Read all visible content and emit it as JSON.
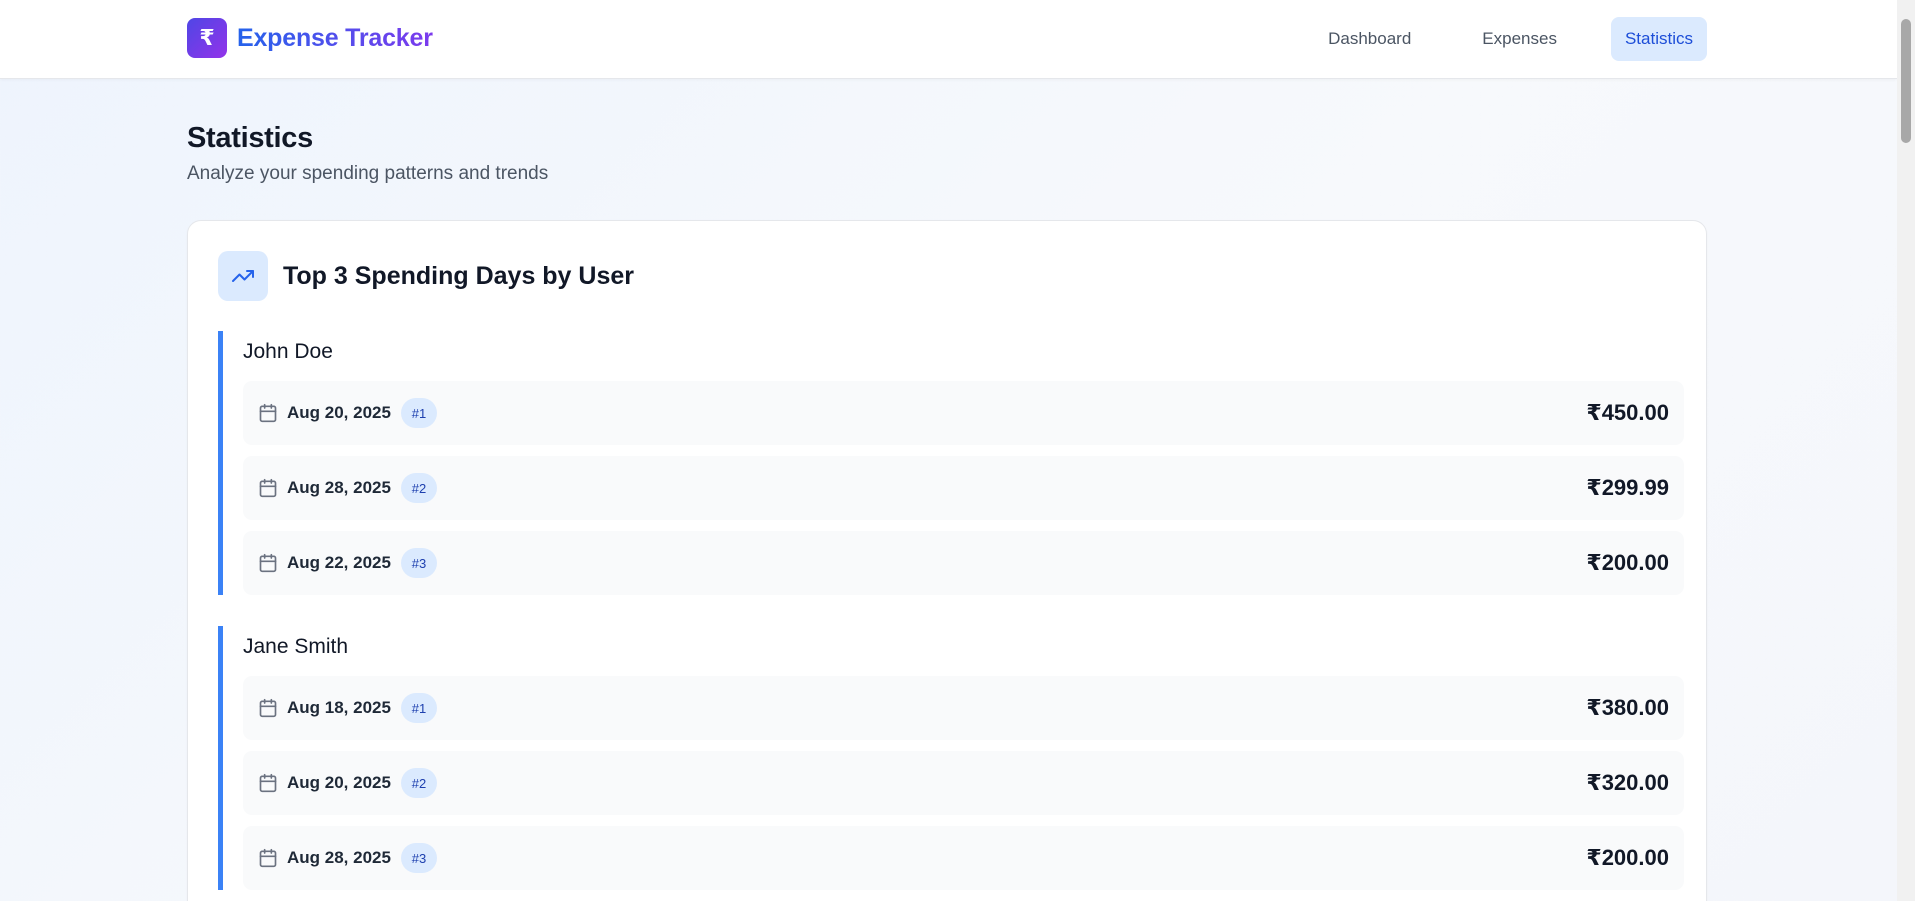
{
  "brand": {
    "logo_symbol": "₹",
    "name": "Expense Tracker"
  },
  "nav": {
    "items": [
      {
        "label": "Dashboard",
        "active": false
      },
      {
        "label": "Expenses",
        "active": false
      },
      {
        "label": "Statistics",
        "active": true
      }
    ]
  },
  "page": {
    "title": "Statistics",
    "subtitle": "Analyze your spending patterns and trends"
  },
  "card": {
    "icon": "trending-up-icon",
    "title": "Top 3 Spending Days by User",
    "users": [
      {
        "name": "John Doe",
        "days": [
          {
            "date": "Aug 20, 2025",
            "rank": "#1",
            "amount": "₹450.00"
          },
          {
            "date": "Aug 28, 2025",
            "rank": "#2",
            "amount": "₹299.99"
          },
          {
            "date": "Aug 22, 2025",
            "rank": "#3",
            "amount": "₹200.00"
          }
        ]
      },
      {
        "name": "Jane Smith",
        "days": [
          {
            "date": "Aug 18, 2025",
            "rank": "#1",
            "amount": "₹380.00"
          },
          {
            "date": "Aug 20, 2025",
            "rank": "#2",
            "amount": "₹320.00"
          },
          {
            "date": "Aug 28, 2025",
            "rank": "#3",
            "amount": "₹200.00"
          }
        ]
      }
    ]
  },
  "colors": {
    "accent": "#3b82f6",
    "active_nav_bg": "#dbeafe",
    "active_nav_text": "#1d4ed8",
    "brand_gradient_start": "#4f46e5",
    "brand_gradient_end": "#9333ea"
  }
}
